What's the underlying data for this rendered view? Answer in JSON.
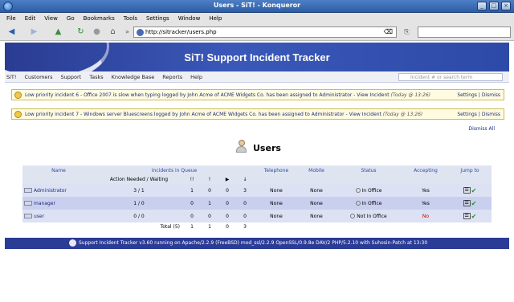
{
  "window": {
    "title": "Users - SiT! - Konqueror"
  },
  "menu": [
    "File",
    "Edit",
    "View",
    "Go",
    "Bookmarks",
    "Tools",
    "Settings",
    "Window",
    "Help"
  ],
  "toolbar": {
    "url": "http://sitracker/users.php"
  },
  "banner": {
    "title": "SiT! Support Incident Tracker"
  },
  "nav": {
    "items": [
      "SiT!",
      "Customers",
      "Support",
      "Tasks",
      "Knowledge Base",
      "Reports",
      "Help"
    ],
    "search_placeholder": "Incident # or search term"
  },
  "notices": [
    {
      "text": "Low priority incident 6 - Office 2007 is slow when typing logged by John Acme of ACME Widgets Co. has been assigned to Administrator - View Incident",
      "time": "(Today @ 13:26)",
      "settings": "Settings",
      "sep": "|",
      "dismiss": "Dismiss"
    },
    {
      "text": "Low priority incident 7 - Windows server Bluescreens logged by John Acme of ACME Widgets Co. has been assigned to Administrator - View Incident",
      "time": "(Today @ 13:26)",
      "settings": "Settings",
      "sep": "|",
      "dismiss": "Dismiss"
    }
  ],
  "dismiss_all": "Dismiss All",
  "heading": "Users",
  "table": {
    "headers": {
      "name": "Name",
      "incidents": "Incidents in Queue",
      "phone": "Telephone",
      "mobile": "Mobile",
      "status": "Status",
      "accepting": "Accepting",
      "jump": "Jump to"
    },
    "subheaders": {
      "action": "Action Needed / Waiting",
      "p1": "!!",
      "p2": "!",
      "p3": "▶",
      "p4": "↓"
    },
    "rows": [
      {
        "name": "Administrator",
        "queue": "3 / 1",
        "p1": "1",
        "p2": "0",
        "p3": "0",
        "p4": "3",
        "phone": "None",
        "mobile": "None",
        "status": "In Office",
        "accepting": "Yes"
      },
      {
        "name": "manager",
        "queue": "1 / 0",
        "p1": "0",
        "p2": "1",
        "p3": "0",
        "p4": "0",
        "phone": "None",
        "mobile": "None",
        "status": "In Office",
        "accepting": "Yes"
      },
      {
        "name": "user",
        "queue": "0 / 0",
        "p1": "0",
        "p2": "0",
        "p3": "0",
        "p4": "0",
        "phone": "None",
        "mobile": "None",
        "status": "Not In Office",
        "accepting": "No"
      }
    ],
    "total": {
      "label": "Total (5)",
      "p1": "1",
      "p2": "1",
      "p3": "0",
      "p4": "3"
    }
  },
  "footer": {
    "text": "Support Incident Tracker v3.60 running on Apache/2.2.9 (FreeBSD) mod_ssl/2.2.9 OpenSSL/0.9.8e DAV/2 PHP/5.2.10 with Suhosin-Patch at 13:30"
  },
  "colors": {
    "banner": "#2f49a6",
    "footer": "#2b3c96",
    "accent_link": "#1d2b7a",
    "no": "#cc0000"
  }
}
